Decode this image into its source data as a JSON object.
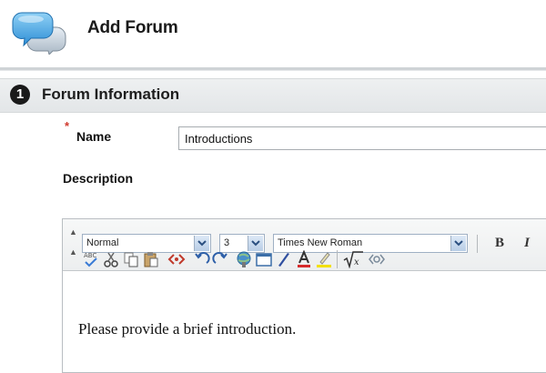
{
  "header": {
    "title": "Add Forum"
  },
  "section": {
    "step_number": "1",
    "title": "Forum Information"
  },
  "form": {
    "name_required_mark": "*",
    "name_label": "Name",
    "name_value": "Introductions",
    "description_label": "Description"
  },
  "editor": {
    "format_value": "Normal",
    "size_value": "3",
    "font_value": "Times New Roman",
    "bold_label": "B",
    "italic_label": "I",
    "content": "Please provide a brief introduction."
  },
  "icons": {
    "forum": "speech-bubbles-icon",
    "spellcheck": "spellcheck-icon",
    "cut": "cut-icon",
    "copy": "copy-icon",
    "paste": "paste-icon",
    "html": "html-source-icon",
    "undo": "undo-icon",
    "redo": "redo-icon",
    "link": "link-icon",
    "table": "table-icon",
    "pen": "pen-icon",
    "text_color": "text-color-icon",
    "highlight": "highlight-icon",
    "math": "math-equation-icon"
  },
  "colors": {
    "required": "#d0382b",
    "section_bar": "#e6e8ea",
    "text_color_underline": "#d62b2b",
    "highlight_underline": "#f2e000"
  }
}
